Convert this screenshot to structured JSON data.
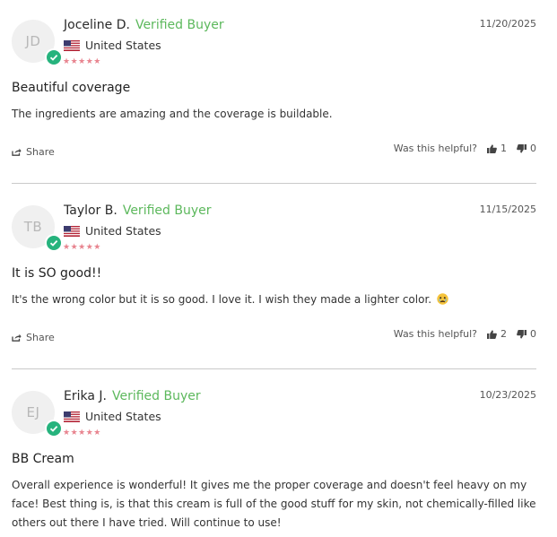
{
  "reviews": [
    {
      "initials": "JD",
      "name": "Joceline D.",
      "verified": "Verified Buyer",
      "country": "United States",
      "rating": 5,
      "stars": "★★★★★",
      "date": "11/20/2025",
      "title": "Beautiful coverage",
      "body": "The ingredients are amazing and the coverage is buildable.",
      "share": "Share",
      "helpful_label": "Was this helpful?",
      "up": "1",
      "down": "0"
    },
    {
      "initials": "TB",
      "name": "Taylor B.",
      "verified": "Verified Buyer",
      "country": "United States",
      "rating": 5,
      "stars": "★★★★★",
      "date": "11/15/2025",
      "title": "It is SO good!!",
      "body": "It's the wrong color but it is so good. I love it. I wish they made a lighter color.",
      "emoji": "crying-face-emoji",
      "share": "Share",
      "helpful_label": "Was this helpful?",
      "up": "2",
      "down": "0"
    },
    {
      "initials": "EJ",
      "name": "Erika J.",
      "verified": "Verified Buyer",
      "country": "United States",
      "rating": 5,
      "stars": "★★★★★",
      "date": "10/23/2025",
      "title": "BB Cream",
      "body": "Overall experience is wonderful! It gives me the proper coverage and doesn't feel heavy on my face! Best thing is, is that this cream is full of the good stuff for my skin, not chemically-filled like others out there I have tried. Will continue to use!"
    }
  ],
  "colors": {
    "verified": "#5cb85c",
    "stars": "#e8848f",
    "badge": "#26b37d",
    "divider": "#c9c9c9"
  }
}
